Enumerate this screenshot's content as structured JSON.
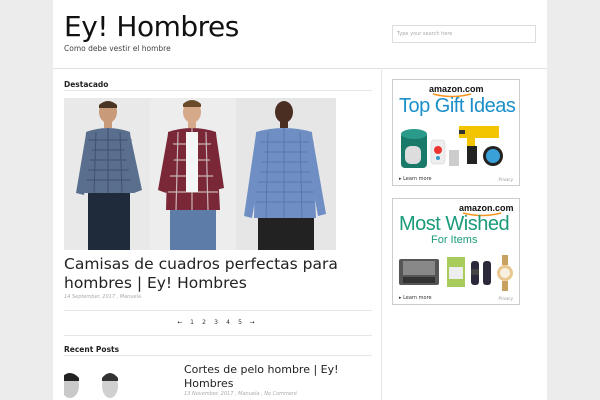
{
  "site": {
    "title": "Ey! Hombres",
    "tagline": "Como debe vestir el hombre"
  },
  "search": {
    "placeholder": "Type your search here"
  },
  "featured": {
    "section_title": "Destacado",
    "post_title": "Camisas de cuadros perfectas para hombres | Ey! Hombres",
    "meta": "14 September, 2017 , Manuela"
  },
  "pagination": {
    "prev": "←",
    "pages": [
      "1",
      "2",
      "3",
      "4",
      "5"
    ],
    "next": "→"
  },
  "recent": {
    "section_title": "Recent Posts",
    "post_title": "Cortes de pelo hombre | Ey! Hombres",
    "meta": "13 November, 2017 , Manuela , No Comment"
  },
  "ads": [
    {
      "brand": "amazon.com",
      "headline": "Top Gift Ideas",
      "subline": "",
      "more": "▸ Learn more",
      "privacy": "Privacy",
      "accent": "#1b8fc9"
    },
    {
      "brand": "amazon.com",
      "headline": "Most Wished",
      "subline": "For Items",
      "more": "▸ Learn more",
      "privacy": "Privacy",
      "accent": "#1b9b7a"
    }
  ],
  "colors": {
    "background": "#ececec",
    "page": "#ffffff",
    "amazon_orange": "#f7931e"
  }
}
